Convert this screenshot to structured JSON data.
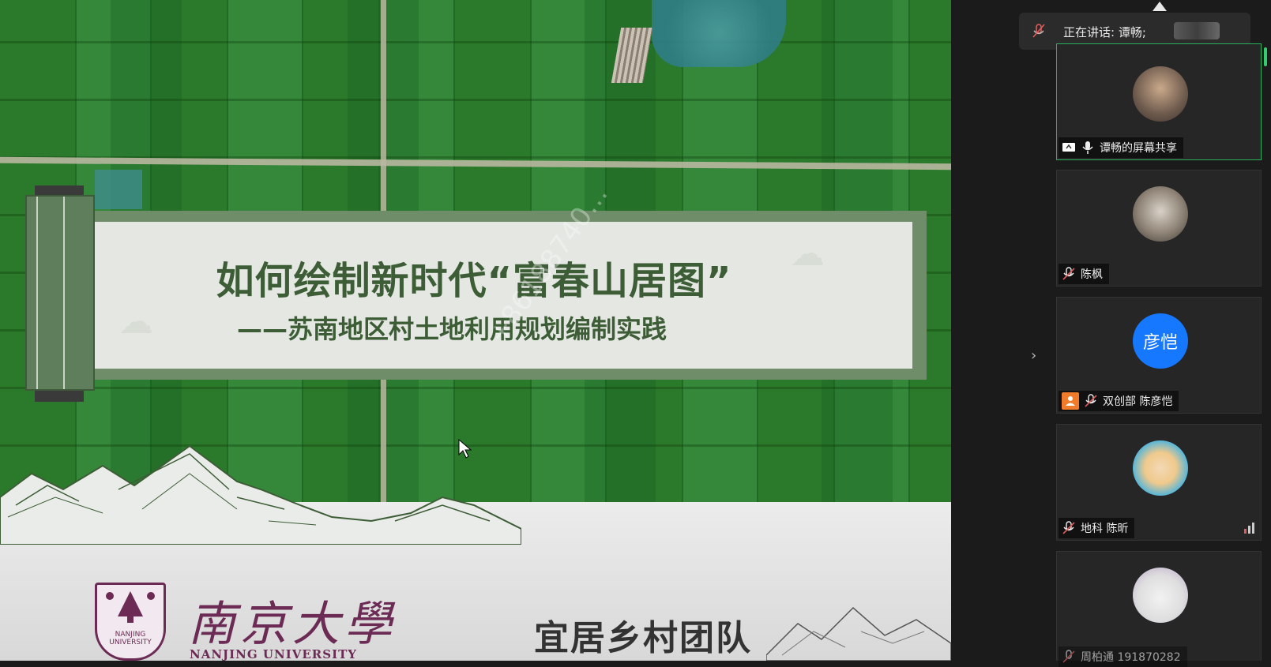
{
  "slide": {
    "title": "如何绘制新时代“富春山居图”",
    "subtitle": "——苏南地区村土地利用规划编制实践",
    "university_cn": "南京大學",
    "university_en": "NANJING UNIVERSITY",
    "emblem_text": "NANJING UNIVERSITY",
    "team": "宜居乡村团队",
    "watermark": "+86188740…"
  },
  "speaking_bar": {
    "label": "正在讲话: 谭畅;"
  },
  "participants": [
    {
      "name": "谭畅的屏幕共享",
      "avatar": "photo",
      "mic": "on",
      "screen_share": true,
      "active": true
    },
    {
      "name": "陈枫",
      "avatar": "photo",
      "mic": "muted"
    },
    {
      "name": "双创部 陈彦恺",
      "avatar_text": "彦恺",
      "mic": "muted",
      "host": true
    },
    {
      "name": "地科 陈昕",
      "avatar": "photo",
      "mic": "muted",
      "signal": true
    },
    {
      "name": "周柏通 191870282",
      "avatar": "photo",
      "mic": "muted"
    }
  ],
  "colors": {
    "slide_green": "#3d5d36",
    "nju_purple": "#6b2b54",
    "active_border": "#2bb05e",
    "avatar_blue": "#1677ff",
    "host_orange": "#f07b2a"
  },
  "icons": [
    "mic-muted-icon",
    "mic-icon",
    "screen-share-icon",
    "host-icon",
    "chevron-right-icon",
    "signal-icon",
    "cursor-icon"
  ]
}
